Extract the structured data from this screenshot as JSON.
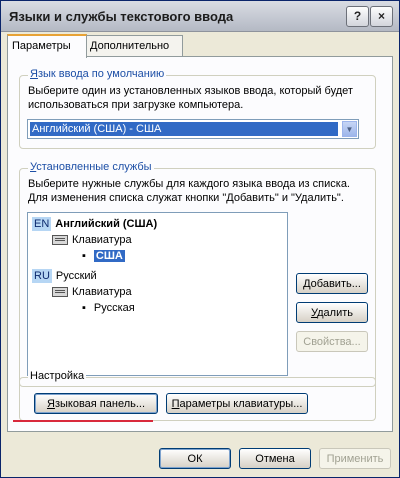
{
  "window": {
    "title": "Языки и службы текстового ввода",
    "help_button": "?",
    "close_button": "×"
  },
  "tabs": [
    {
      "label": "Параметры",
      "active": true
    },
    {
      "label": "Дополнительно",
      "active": false
    }
  ],
  "default_language": {
    "group_label_hotkey": "Я",
    "group_label_rest": "зык ввода по умолчанию",
    "description_line1": "Выберите один из установленных языков ввода, который будет",
    "description_line2": "использоваться при загрузке компьютера.",
    "selected_value": "Английский (США) - США"
  },
  "installed_services": {
    "group_label_hotkey": "У",
    "group_label_rest": "становленные службы",
    "description_line1": "Выберите нужные службы для каждого языка ввода из списка.",
    "description_line2": "Для изменения списка служат кнопки \"Добавить\" и \"Удалить\".",
    "tree": [
      {
        "tag": "EN",
        "language": "Английский (США)",
        "type_label": "Клавиатура",
        "layout": "США",
        "selected": true
      },
      {
        "tag": "RU",
        "language": "Русский",
        "type_label": "Клавиатура",
        "layout": "Русская",
        "selected": false
      }
    ],
    "add_button_hotkey": "Д",
    "add_button_rest": "обавить...",
    "remove_button_hotkey": "У",
    "remove_button_rest": "далить",
    "properties_button": "Свойства..."
  },
  "settings": {
    "group_label": "Настройка",
    "language_bar_button_hotkey": "Я",
    "language_bar_button_rest": "зыковая панель...",
    "key_settings_button_hotkey": "П",
    "key_settings_button_rest": "араметры клавиатуры..."
  },
  "footer": {
    "ok_button": "ОК",
    "cancel_button": "Отмена",
    "apply_button": "Применить"
  },
  "colors": {
    "selection": "#316ac5",
    "group_label": "#1d4fa6",
    "annotation_underline": "#d8283b"
  }
}
